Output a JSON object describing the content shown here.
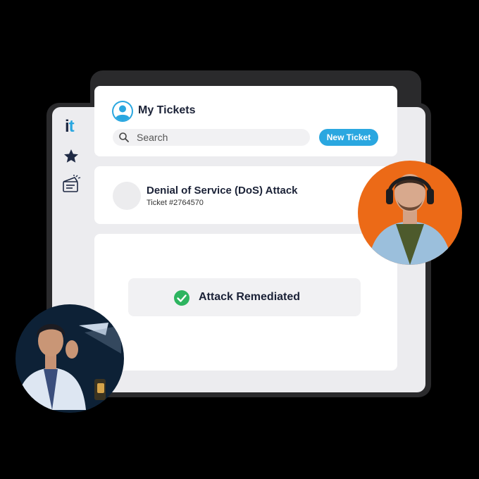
{
  "app": {
    "logo_i": "i",
    "logo_t": "t",
    "title": "My Tickets"
  },
  "search": {
    "placeholder": "Search"
  },
  "toolbar": {
    "new_ticket_label": "New Ticket"
  },
  "ticket": {
    "title": "Denial of Service (DoS) Attack",
    "number": "Ticket #2764570"
  },
  "status": {
    "text": "Attack Remediated"
  },
  "colors": {
    "accent": "#2aa7e0",
    "success": "#2db45f",
    "avatar_bg_right": "#ec6a17",
    "avatar_bg_left": "#0d2136"
  },
  "icons": {
    "sidebar": [
      "star-icon",
      "ticket-icon"
    ],
    "header": "user-avatar-icon",
    "search": "search-icon",
    "status": "check-circle-icon"
  }
}
